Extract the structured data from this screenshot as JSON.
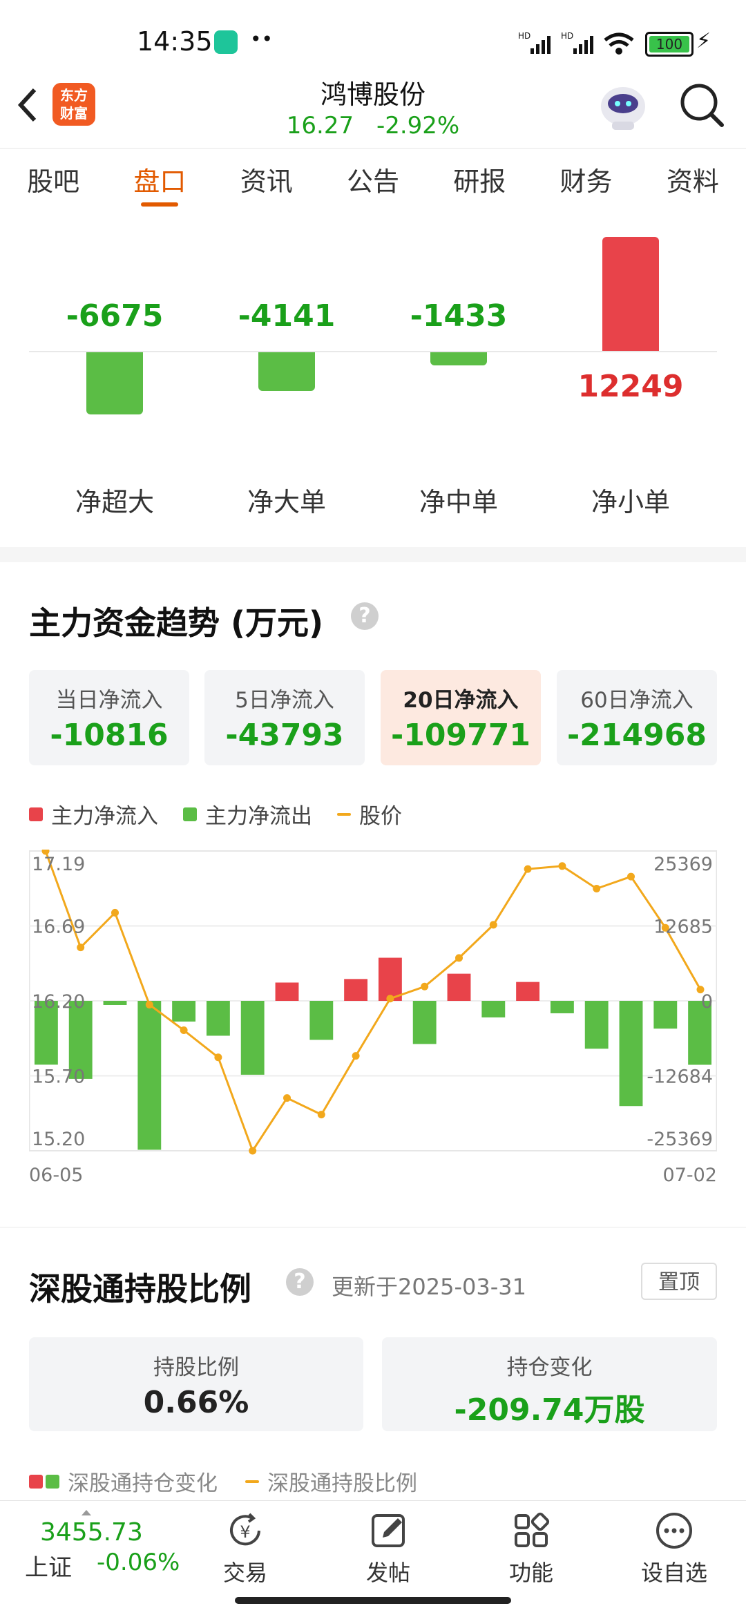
{
  "status_bar": {
    "time": "14:35",
    "battery": "100"
  },
  "header": {
    "app_logo": "东方\n财富",
    "stock_name": "鸿博股份",
    "price": "16.27",
    "change": "-2.92%"
  },
  "tabs": [
    {
      "label": "股吧"
    },
    {
      "label": "盘口"
    },
    {
      "label": "资讯"
    },
    {
      "label": "公告"
    },
    {
      "label": "研报"
    },
    {
      "label": "财务"
    },
    {
      "label": "资料"
    }
  ],
  "active_tab": "盘口",
  "net_flow": {
    "items": [
      {
        "label": "净超大",
        "value": "-6675",
        "amount": -6675
      },
      {
        "label": "净大单",
        "value": "-4141",
        "amount": -4141
      },
      {
        "label": "净中单",
        "value": "-1433",
        "amount": -1433
      },
      {
        "label": "净小单",
        "value": "12249",
        "amount": 12249
      }
    ]
  },
  "trend": {
    "title": "主力资金趋势 (万元)",
    "cards": [
      {
        "label": "当日净流入",
        "value": "-10816"
      },
      {
        "label": "5日净流入",
        "value": "-43793"
      },
      {
        "label": "20日净流入",
        "value": "-109771"
      },
      {
        "label": "60日净流入",
        "value": "-214968"
      }
    ],
    "legend": {
      "inflow": "主力净流入",
      "outflow": "主力净流出",
      "price": "股价"
    }
  },
  "chart_data": {
    "type": "bar",
    "xlabel": "",
    "ylabel": "",
    "x_start": "06-05",
    "x_end": "07-02",
    "left_ticks": [
      "17.19",
      "16.69",
      "16.20",
      "15.70",
      "15.20"
    ],
    "right_ticks": [
      "25369",
      "12685",
      "0",
      "-12684",
      "-25369"
    ],
    "price_range": [
      15.2,
      17.19
    ],
    "flow_range": [
      -25369,
      25369
    ],
    "series": [
      {
        "name": "主力净流入/净流出",
        "values": [
          -10800,
          -13200,
          -700,
          -25200,
          -3500,
          -5900,
          -12500,
          3100,
          -6600,
          3700,
          7300,
          -7300,
          4600,
          -2800,
          3200,
          -2100,
          -8100,
          -17800,
          -4700,
          -10816
        ]
      },
      {
        "name": "股价",
        "values": [
          17.19,
          16.55,
          16.78,
          16.17,
          16.0,
          15.82,
          15.2,
          15.55,
          15.44,
          15.83,
          16.21,
          16.29,
          16.48,
          16.7,
          17.07,
          17.09,
          16.94,
          17.02,
          16.68,
          16.27
        ]
      }
    ],
    "colors": {
      "inflow": "#e8434a",
      "outflow": "#5bbd45",
      "price": "#f2a81c"
    }
  },
  "holding": {
    "title": "深股通持股比例",
    "updated": "更新于2025-03-31",
    "pin_label": "置顶",
    "cards": [
      {
        "label": "持股比例",
        "value": "0.66%"
      },
      {
        "label": "持仓变化",
        "value": "-209.74万股"
      }
    ],
    "legend": {
      "change": "深股通持仓变化",
      "ratio": "深股通持股比例"
    }
  },
  "bottom_bar": {
    "index_value": "3455.73",
    "index_name": "上证",
    "index_change": "-0.06%",
    "items": [
      {
        "label": "交易",
        "icon": "yen-exchange-icon"
      },
      {
        "label": "发帖",
        "icon": "edit-post-icon"
      },
      {
        "label": "功能",
        "icon": "grid-apps-icon"
      },
      {
        "label": "设自选",
        "icon": "more-dots-icon"
      }
    ]
  }
}
